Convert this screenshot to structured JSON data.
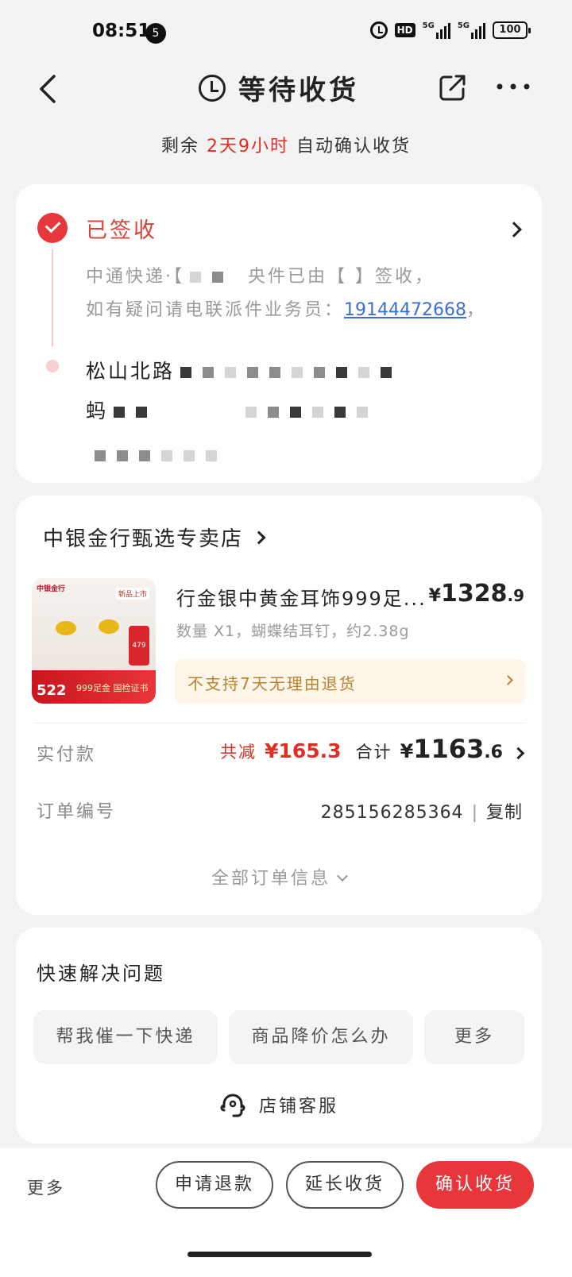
{
  "status_bar": {
    "time": "08:51",
    "notification_count": "5",
    "hd_label": "HD",
    "signal1_label": "5G",
    "signal2_label": "5G",
    "battery": "100"
  },
  "nav": {
    "title": "等待收货"
  },
  "countdown": {
    "prefix": "剩余 ",
    "remaining": "2天9小时",
    "suffix": " 自动确认收货"
  },
  "logistics": {
    "status": "已签收",
    "line1_prefix": "中通快递·【",
    "line1_suffix": "央件已由【 】签收，",
    "line2_prefix": "如有疑问请电联派件业务员：",
    "phone": "19144472668",
    "line2_suffix": "，",
    "address_prefix": "松山北路",
    "address_line2_prefix": "蚂"
  },
  "order": {
    "shop_name": "中银金行甄选专卖店",
    "product_image": {
      "brand": "中银金行",
      "tag": "新品上市",
      "side_price": "479",
      "price": "522",
      "gold_text": "999足金 国检证书"
    },
    "product_name": "行金银中黄金耳饰999足...",
    "price_currency": "¥",
    "price_int": "1328",
    "price_dec": ".9",
    "spec": "数量 X1，蝴蝶结耳钉，约2.38g",
    "return_notice": "不支持7天无理由退货",
    "paid_label": "实付款",
    "discount_label": "共减",
    "discount_value": "¥165.3",
    "total_label": "合计",
    "total_currency": "¥",
    "total_int": "1163",
    "total_dec": ".6",
    "order_no_label": "订单编号",
    "order_no": "285156285364",
    "copy_label": "复制",
    "all_info_label": "全部订单信息"
  },
  "quick": {
    "title": "快速解决问题",
    "chips": [
      "帮我催一下快递",
      "商品降价怎么办",
      "更多"
    ],
    "service_label": "店铺客服"
  },
  "bottom": {
    "more_label": "更多",
    "refund_label": "申请退款",
    "extend_label": "延长收货",
    "confirm_label": "确认收货"
  },
  "colors": {
    "accent": "#e8373b",
    "price_red": "#e02e24",
    "link_blue": "#3b6fd1",
    "notice_text": "#b98330"
  }
}
